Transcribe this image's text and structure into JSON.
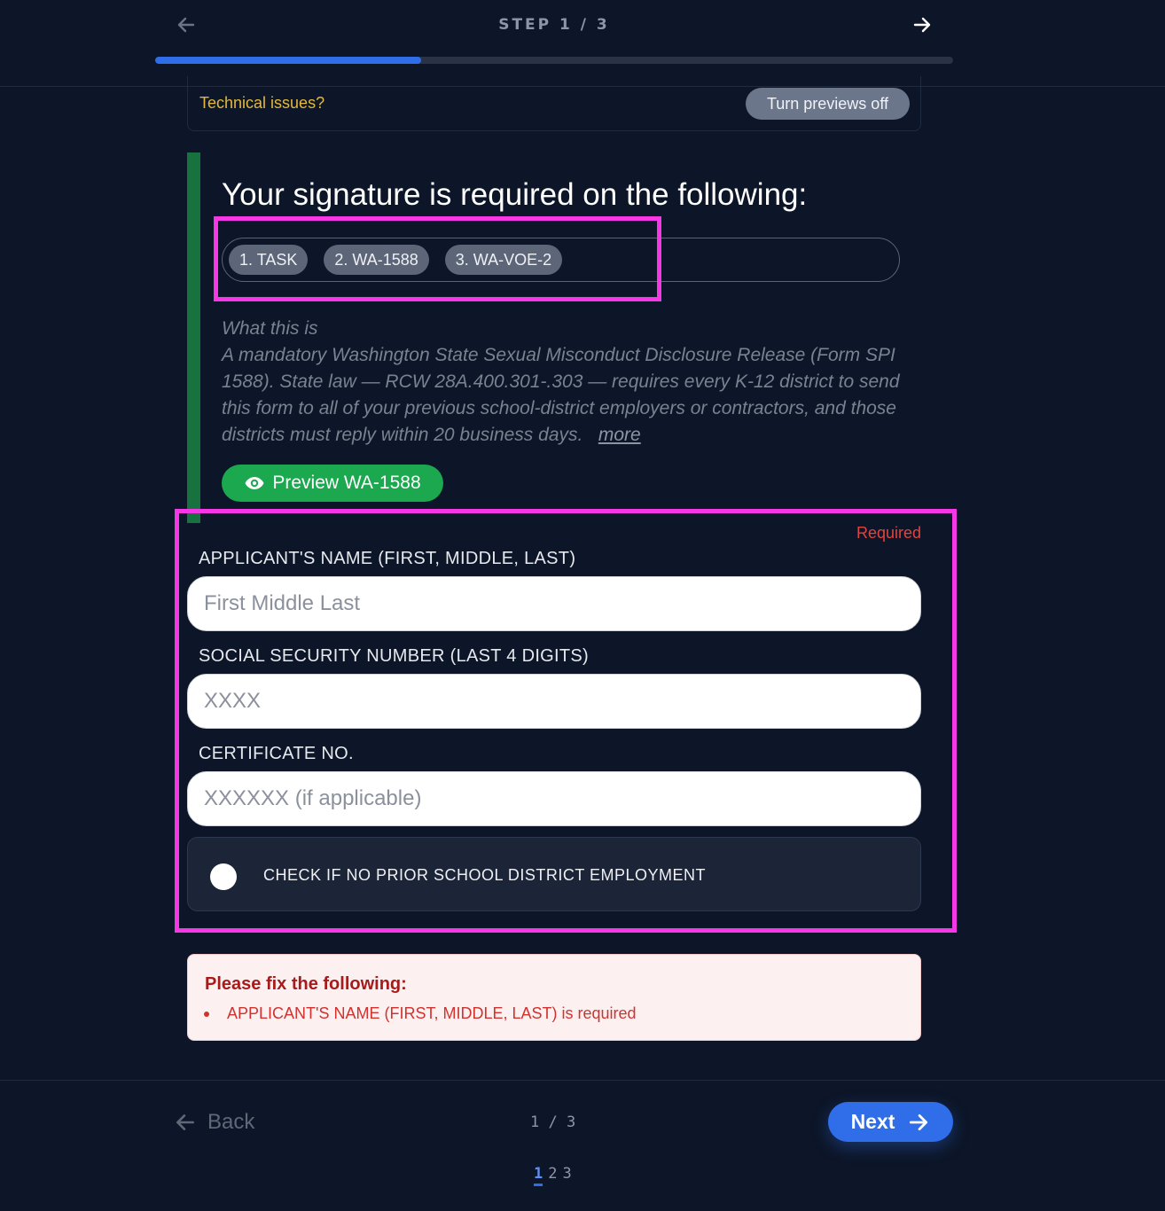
{
  "header": {
    "step_label": "STEP 1 / 3",
    "progress_fraction": 0.333,
    "back_icon": "arrow-left-icon",
    "forward_icon": "arrow-right-icon"
  },
  "tech_bar": {
    "issues_text": "Technical issues?",
    "toggle_label": "Turn previews off"
  },
  "signature": {
    "title": "Your signature is required on the following:",
    "chips": [
      "1. TASK",
      "2. WA-1588",
      "3. WA-VOE-2"
    ],
    "what_heading": "What this is",
    "description": "A mandatory Washington State Sexual Misconduct Disclosure Release (Form SPI 1588). State law — RCW 28A.400.301-.303 — requires every K-12 district to send this form to all of your previous school-district employers or contractors, and those districts must reply within 20 business days.",
    "more_link": "more",
    "preview_label": "Preview WA-1588",
    "preview_icon": "eye-icon"
  },
  "form": {
    "required_label": "Required",
    "fields": [
      {
        "label": "APPLICANT'S NAME (FIRST, MIDDLE, LAST)",
        "placeholder": "First Middle Last",
        "value": ""
      },
      {
        "label": "SOCIAL SECURITY NUMBER (LAST 4 DIGITS)",
        "placeholder": "XXXX",
        "value": ""
      },
      {
        "label": "CERTIFICATE NO.",
        "placeholder": "XXXXXX (if applicable)",
        "value": ""
      }
    ],
    "checkbox_label": "CHECK IF NO PRIOR SCHOOL DISTRICT EMPLOYMENT",
    "checkbox_checked": false
  },
  "errors": {
    "title": "Please fix the following:",
    "items": [
      "APPLICANT'S NAME (FIRST, MIDDLE, LAST) is required"
    ]
  },
  "footer": {
    "back_label": "Back",
    "page_count": "1 / 3",
    "next_label": "Next",
    "pages": [
      "1",
      "2",
      "3"
    ],
    "current_page": "1"
  },
  "colors": {
    "background": "#0d1628",
    "accent_blue": "#2f6ee8",
    "success_green": "#1ba84e",
    "card_bar_green": "#177240",
    "highlight_magenta": "#f637e6",
    "warning_yellow": "#e2b83e",
    "error_red": "#d2322e"
  }
}
